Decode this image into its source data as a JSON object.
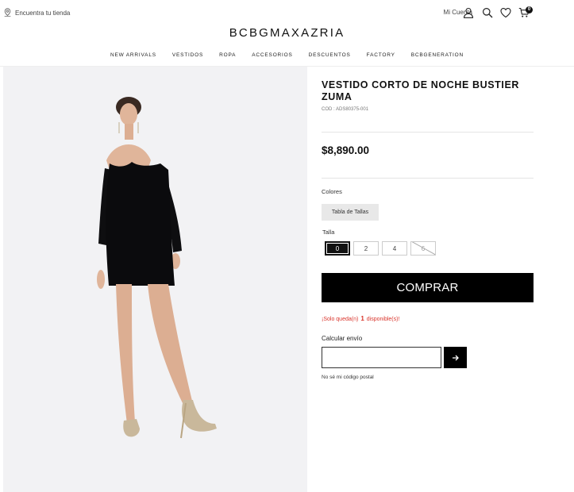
{
  "header": {
    "store_locator": "Encuentra tu tienda",
    "account_label": "Mi Cuenta",
    "cart_count": "0",
    "brand": "BCBGMAXAZRIA",
    "icons": [
      "location-pin-icon",
      "user-icon",
      "search-icon",
      "heart-icon",
      "cart-icon"
    ]
  },
  "nav": {
    "items": [
      "NEW ARRIVALS",
      "VESTIDOS",
      "ROPA",
      "ACCESORIOS",
      "DESCUENTOS",
      "FACTORY",
      "BCBGENERATION"
    ]
  },
  "product": {
    "title": "VESTIDO CORTO DE NOCHE BUSTIER ZUMA",
    "sku": "COD : ADS80375-001",
    "price": "$8,890.00",
    "colors_label": "Colores",
    "size_chart_label": "Tabla de Tallas",
    "size_label": "Talla",
    "sizes": [
      {
        "label": "0",
        "state": "selected"
      },
      {
        "label": "2",
        "state": "available"
      },
      {
        "label": "4",
        "state": "available"
      },
      {
        "label": "6",
        "state": "unavailable"
      }
    ],
    "buy_label": "COMPRAR",
    "stock": {
      "prefix": "¡Solo queda(n)",
      "count": "1",
      "suffix": "disponible(s)!"
    }
  },
  "shipping": {
    "label": "Calcular envío",
    "input_value": "",
    "input_placeholder": "",
    "no_zip_link": "No sé mi código postal"
  },
  "colors": {
    "accent": "#000000",
    "stock_alert": "#d9342b",
    "size_chart_bg": "#e8e8e8"
  }
}
